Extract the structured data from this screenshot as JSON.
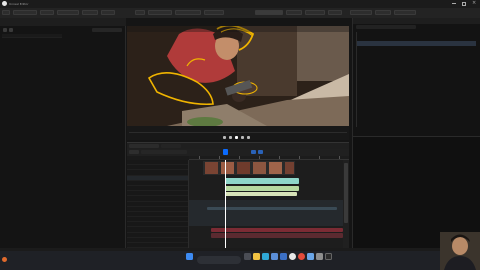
{
  "app": {
    "title": "Unreal Editor",
    "accent": "#0a6bff"
  },
  "menu": {
    "items": [
      "",
      "",
      "",
      "",
      "",
      ""
    ]
  },
  "toolbar": {
    "left_buttons": [
      "",
      "",
      ""
    ],
    "right_buttons": [
      "",
      "",
      ""
    ]
  },
  "left_panel": {
    "title": "",
    "tabs": [
      "",
      ""
    ]
  },
  "viewport": {
    "label": ""
  },
  "outliner": {
    "items": [
      "",
      "",
      "",
      "",
      "",
      "",
      "",
      "",
      "",
      "",
      "",
      "",
      "",
      "",
      "",
      "",
      "",
      "",
      "",
      "",
      ""
    ]
  },
  "sequencer": {
    "tabs": [
      "",
      ""
    ],
    "tracks": [
      "",
      "",
      "",
      "",
      "",
      "",
      "",
      "",
      "",
      "",
      "",
      "",
      "",
      "",
      "",
      "",
      ""
    ],
    "clip_colors": {
      "camera": "#8fd6c9",
      "shot": "#b7d9a0",
      "audio": "#7b2b34",
      "event": "#3a4a55"
    }
  },
  "taskbar": {
    "weather": "",
    "search_placeholder": "",
    "time": "",
    "icons": [
      "windows-icon",
      "search-icon",
      "task-view-icon",
      "explorer-icon",
      "edge-icon",
      "store-icon",
      "mail-icon",
      "unreal-icon",
      "chrome-icon",
      "photos-icon",
      "settings-icon",
      "terminal-icon"
    ]
  }
}
